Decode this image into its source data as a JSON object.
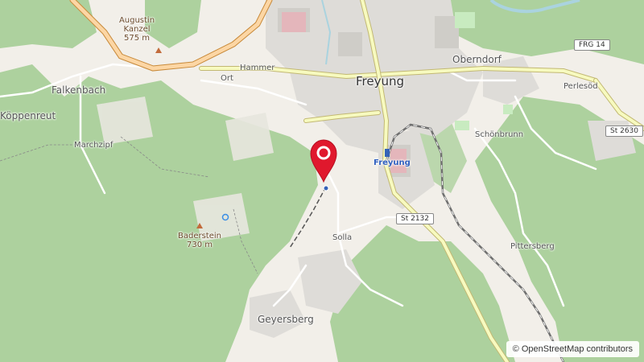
{
  "map": {
    "labels": {
      "freyung": "Freyung",
      "oberndorf": "Oberndorf",
      "falkenbach": "Falkenbach",
      "koppenreut": "Köppenreut",
      "marchzipf": "Marchzipf",
      "hammer": "Hammer",
      "ort": "Ort",
      "perlesod": "Perlesöd",
      "schonbrunn": "Schönbrunn",
      "pittersberg": "Pittersberg",
      "solla": "Solla",
      "geyersberg": "Geyersberg",
      "station": "Freyung"
    },
    "peaks": {
      "augustin_name_line1": "Augustin",
      "augustin_name_line2": "Kanzel",
      "augustin_elev": "575 m",
      "baderstein_name": "Baderstein",
      "baderstein_elev": "730 m"
    },
    "road_shields": {
      "frg14": "FRG 14",
      "st2630": "St 2630",
      "st2132": "St 2132"
    },
    "attribution": "© OpenStreetMap contributors",
    "marker_icon": "location-pin-icon",
    "colors": {
      "forest": "#add19e",
      "land": "#f2efe9",
      "urban": "#e0dfdf",
      "primary_road": "#f7fabf",
      "primary_road_casing": "#c2b873",
      "trunk_road": "#fcd6a4",
      "trunk_casing": "#c88a3b",
      "marker": "#e0182d",
      "station_text": "#2f5fbf",
      "water": "#aad3df"
    }
  }
}
